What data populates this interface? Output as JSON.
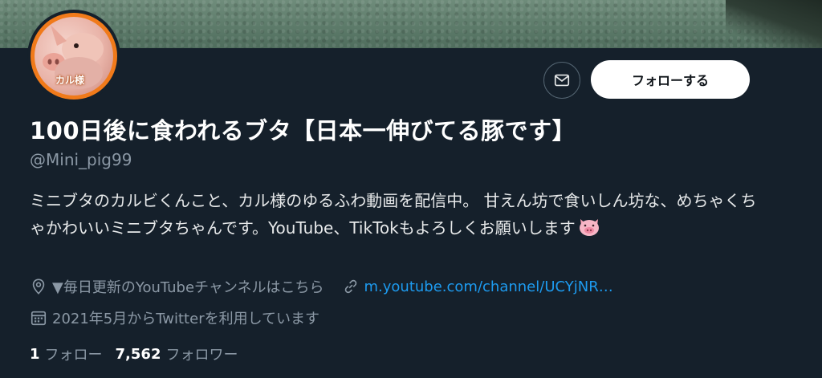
{
  "profile": {
    "avatar_label": "カル様",
    "display_name": "100日後に食われるブタ【日本一伸びてる豚です】",
    "handle": "@Mini_pig99",
    "bio": "ミニブタのカルビくんこと、カル様のゆるふわ動画を配信中。 甘えん坊で食いしん坊な、めちゃくちゃかわいいミニブタちゃんです。YouTube、TikTokもよろしくお願いします",
    "location": "▼毎日更新のYouTubeチャンネルはこちら",
    "website": "m.youtube.com/channel/UCYjNR…",
    "joined": "2021年5月からTwitterを利用しています",
    "following_count": "1",
    "following_label": "フォロー",
    "followers_count": "7,562",
    "followers_label": "フォロワー"
  },
  "actions": {
    "follow_label": "フォローする",
    "message_icon": "envelope-icon"
  },
  "icons": {
    "location": "location-pin-icon",
    "link": "link-icon",
    "calendar": "calendar-icon",
    "bio_emoji": "pig-face-emoji"
  },
  "colors": {
    "background": "#15202b",
    "text_secondary": "#8b98a5",
    "link": "#1d9bf0",
    "avatar_ring": "#f07a1a"
  }
}
